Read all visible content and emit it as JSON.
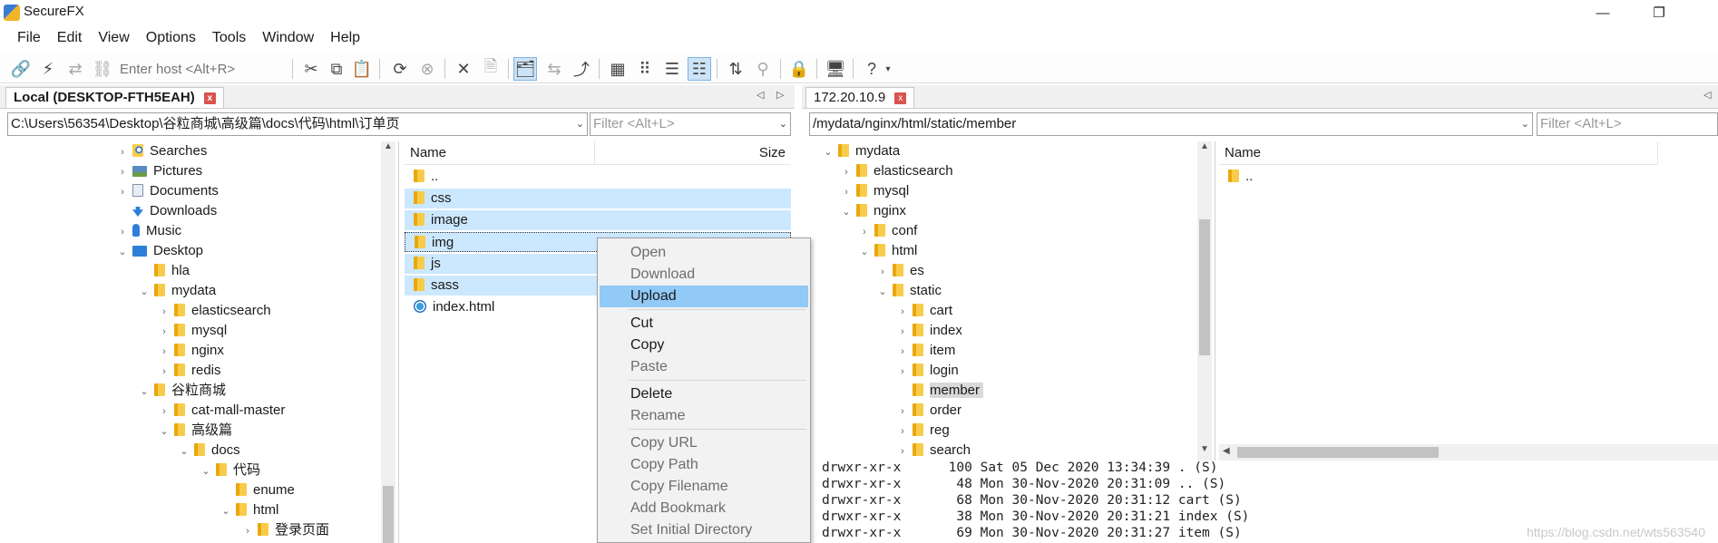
{
  "app": {
    "title": "SecureFX"
  },
  "window_controls": {
    "minimize": "—",
    "maximize": "❐"
  },
  "menu": [
    "File",
    "Edit",
    "View",
    "Options",
    "Tools",
    "Window",
    "Help"
  ],
  "toolbar": {
    "host_placeholder": "Enter host <Alt+R>"
  },
  "local": {
    "tab_label": "Local (DESKTOP-FTH5EAH)",
    "path": "C:\\Users\\56354\\Desktop\\谷粒商城\\高级篇\\docs\\代码\\html\\订单页",
    "filter_placeholder": "Filter <Alt+L>",
    "tree": [
      {
        "label": "Searches",
        "exp": "›",
        "icon": "search-folder-icon"
      },
      {
        "label": "Pictures",
        "exp": "›",
        "icon": "pictures-icon"
      },
      {
        "label": "Documents",
        "exp": "›",
        "icon": "documents-icon"
      },
      {
        "label": "Downloads",
        "exp": "",
        "icon": "downloads-icon"
      },
      {
        "label": "Music",
        "exp": "›",
        "icon": "music-icon"
      },
      {
        "label": "Desktop",
        "exp": "⌄",
        "icon": "desktop-icon"
      },
      {
        "label": "hla",
        "exp": "",
        "icon": "folder-icon"
      },
      {
        "label": "mydata",
        "exp": "⌄",
        "icon": "folder-icon"
      },
      {
        "label": "elasticsearch",
        "exp": "›",
        "icon": "folder-icon"
      },
      {
        "label": "mysql",
        "exp": "›",
        "icon": "folder-icon"
      },
      {
        "label": "nginx",
        "exp": "›",
        "icon": "folder-icon"
      },
      {
        "label": "redis",
        "exp": "›",
        "icon": "folder-icon"
      },
      {
        "label": "谷粒商城",
        "exp": "⌄",
        "icon": "folder-icon"
      },
      {
        "label": "cat-mall-master",
        "exp": "›",
        "icon": "folder-icon"
      },
      {
        "label": "高级篇",
        "exp": "⌄",
        "icon": "folder-icon"
      },
      {
        "label": "docs",
        "exp": "⌄",
        "icon": "folder-icon"
      },
      {
        "label": "代码",
        "exp": "⌄",
        "icon": "folder-icon"
      },
      {
        "label": "enume",
        "exp": "",
        "icon": "folder-icon"
      },
      {
        "label": "html",
        "exp": "⌄",
        "icon": "folder-icon"
      },
      {
        "label": "登录页面",
        "exp": "›",
        "icon": "folder-icon"
      }
    ],
    "columns": {
      "name": "Name",
      "size": "Size"
    },
    "files": [
      {
        "name": "..",
        "icon": "folder-icon"
      },
      {
        "name": "css",
        "icon": "folder-icon"
      },
      {
        "name": "image",
        "icon": "folder-icon"
      },
      {
        "name": "img",
        "icon": "folder-icon"
      },
      {
        "name": "js",
        "icon": "folder-icon"
      },
      {
        "name": "sass",
        "icon": "folder-icon"
      },
      {
        "name": "index.html",
        "icon": "html-file-icon"
      }
    ]
  },
  "remote": {
    "tab_label": "172.20.10.9",
    "path": "/mydata/nginx/html/static/member",
    "filter_placeholder": "Filter <Alt+L>",
    "tree": [
      {
        "label": "mydata",
        "exp": "⌄"
      },
      {
        "label": "elasticsearch",
        "exp": "›"
      },
      {
        "label": "mysql",
        "exp": "›"
      },
      {
        "label": "nginx",
        "exp": "⌄"
      },
      {
        "label": "conf",
        "exp": "›"
      },
      {
        "label": "html",
        "exp": "⌄"
      },
      {
        "label": "es",
        "exp": "›"
      },
      {
        "label": "static",
        "exp": "⌄"
      },
      {
        "label": "cart",
        "exp": "›"
      },
      {
        "label": "index",
        "exp": "›"
      },
      {
        "label": "item",
        "exp": "›"
      },
      {
        "label": "login",
        "exp": "›"
      },
      {
        "label": "member",
        "exp": ""
      },
      {
        "label": "order",
        "exp": "›"
      },
      {
        "label": "reg",
        "exp": "›"
      },
      {
        "label": "search",
        "exp": "›"
      }
    ],
    "columns": {
      "name": "Name"
    },
    "files": [
      {
        "name": ".."
      }
    ]
  },
  "context_menu": [
    {
      "label": "Open",
      "enabled": false
    },
    {
      "label": "Download",
      "enabled": false
    },
    {
      "label": "Upload",
      "enabled": true,
      "highlighted": true
    },
    {
      "label": "Cut",
      "enabled": true
    },
    {
      "label": "Copy",
      "enabled": true
    },
    {
      "label": "Paste",
      "enabled": false
    },
    {
      "label": "Delete",
      "enabled": true
    },
    {
      "label": "Rename",
      "enabled": false
    },
    {
      "label": "Copy URL",
      "enabled": false
    },
    {
      "label": "Copy Path",
      "enabled": false
    },
    {
      "label": "Copy Filename",
      "enabled": false
    },
    {
      "label": "Add Bookmark",
      "enabled": false
    },
    {
      "label": "Set Initial Directory",
      "enabled": false
    }
  ],
  "log": [
    "drwxr-xr-x      100 Sat 05 Dec 2020 13:34:39 . (S)",
    "drwxr-xr-x       48 Mon 30-Nov-2020 20:31:09 .. (S)",
    "drwxr-xr-x       68 Mon 30-Nov-2020 20:31:12 cart (S)",
    "drwxr-xr-x       38 Mon 30-Nov-2020 20:31:21 index (S)",
    "drwxr-xr-x       69 Mon 30-Nov-2020 20:31:27 item (S)"
  ],
  "watermark": "https://blog.csdn.net/wts563540"
}
